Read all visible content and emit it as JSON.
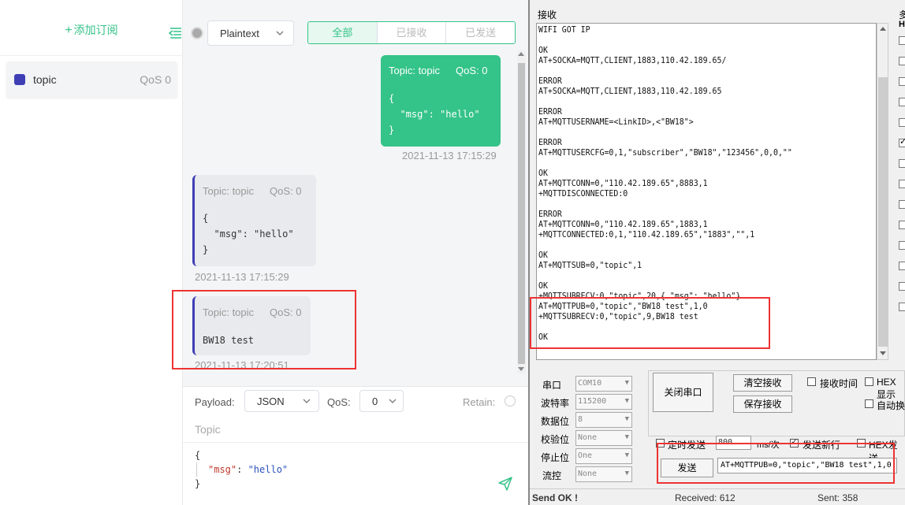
{
  "sidebar": {
    "add_subscription": "添加订阅",
    "topics": [
      {
        "name": "topic",
        "qos": "QoS 0",
        "color": "#3f3fb5"
      }
    ]
  },
  "toolbar": {
    "format": "Plaintext",
    "tabs": [
      "全部",
      "已接收",
      "已发送"
    ]
  },
  "messages": [
    {
      "direction": "out",
      "topic": "Topic: topic",
      "qos": "QoS: 0",
      "payload": "{\n  \"msg\": \"hello\"\n}",
      "time": "2021-11-13 17:15:29"
    },
    {
      "direction": "in",
      "topic": "Topic: topic",
      "qos": "QoS: 0",
      "payload": "{\n  \"msg\": \"hello\"\n}",
      "time": "2021-11-13 17:15:29"
    },
    {
      "direction": "in",
      "topic": "Topic: topic",
      "qos": "QoS: 0",
      "payload": "BW18 test",
      "time": "2021-11-13 17:20:51"
    }
  ],
  "payload_panel": {
    "payload_label": "Payload:",
    "payload_format": "JSON",
    "qos_label": "QoS:",
    "qos_value": "0",
    "retain_label": "Retain:",
    "topic_placeholder": "Topic",
    "code_open": "{",
    "code_key": "\"msg\"",
    "code_colon": ": ",
    "code_value": "\"hello\"",
    "code_close": "}"
  },
  "serial": {
    "receive_label": "接收",
    "multi_label": "多",
    "hi_label": "HI",
    "log": "WIFI GOT IP\n\nOK\nAT+SOCKA=MQTT,CLIENT,1883,110.42.189.65/\n\nERROR\nAT+SOCKA=MQTT,CLIENT,1883,110.42.189.65\n\nERROR\nAT+MQTTUSERNAME=<LinkID>,<\"BW18\">\n\nERROR\nAT+MQTTUSERCFG=0,1,\"subscriber\",\"BW18\",\"123456\",0,0,\"\"\n\nOK\nAT+MQTTCONN=0,\"110.42.189.65\",8883,1\n+MQTTDISCONNECTED:0\n\nERROR\nAT+MQTTCONN=0,\"110.42.189.65\",1883,1\n+MQTTCONNECTED:0,1,\"110.42.189.65\",\"1883\",\"\",1\n\nOK\nAT+MQTTSUB=0,\"topic\",1\n\nOK\n+MQTTSUBRECV:0,\"topic\",20,{ \"msg\": \"hello\"}\nAT+MQTTPUB=0,\"topic\",\"BW18 test\",1,0\n+MQTTSUBRECV:0,\"topic\",9,BW18 test\n\nOK",
    "labels": {
      "port": "串口",
      "baud": "波特率",
      "databits": "数据位",
      "parity": "校验位",
      "stopbits": "停止位",
      "flow": "流控"
    },
    "values": {
      "port": "COM10",
      "baud": "115200",
      "databits": "8",
      "parity": "None",
      "stopbits": "One",
      "flow": "None"
    },
    "buttons": {
      "close_port": "关闭串口",
      "clear_recv": "清空接收",
      "save_recv": "保存接收",
      "send": "发送"
    },
    "options": {
      "recv_time": "接收时间",
      "hex_display": "HEX显示",
      "auto_wrap": "自动换",
      "timed_send": "定时发送",
      "interval": "800",
      "interval_unit": "ms/次",
      "send_newline": "发送新行",
      "hex_send": "HEX发送"
    },
    "send_text": "AT+MQTTPUB=0,\"topic\",\"BW18 test\",1,0",
    "status": {
      "send_ok": "Send OK !",
      "received": "Received: 612",
      "sent": "Sent: 358"
    }
  }
}
